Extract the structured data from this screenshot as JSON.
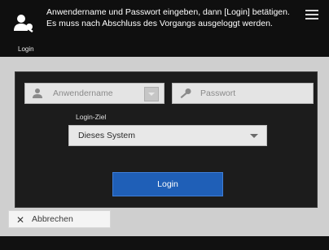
{
  "header": {
    "login_label": "Login",
    "message": "Anwendername und Passwort eingeben, dann [Login] betätigen. Es muss nach Abschluss des Vorgangs ausgeloggt werden."
  },
  "form": {
    "username_placeholder": "Anwendername",
    "password_placeholder": "Passwort",
    "login_target_label": "Login-Ziel",
    "login_target_value": "Dieses System",
    "login_button": "Login"
  },
  "footer": {
    "cancel_label": "Abbrechen"
  },
  "colors": {
    "header_bg": "#0f0f0f",
    "panel_bg": "#1c1c1c",
    "login_button_bg": "#1f5fb7"
  },
  "icons": [
    "user-key-icon",
    "menu-icon",
    "user-icon",
    "dropdown-icon",
    "key-icon",
    "chevron-down-icon",
    "close-icon"
  ]
}
